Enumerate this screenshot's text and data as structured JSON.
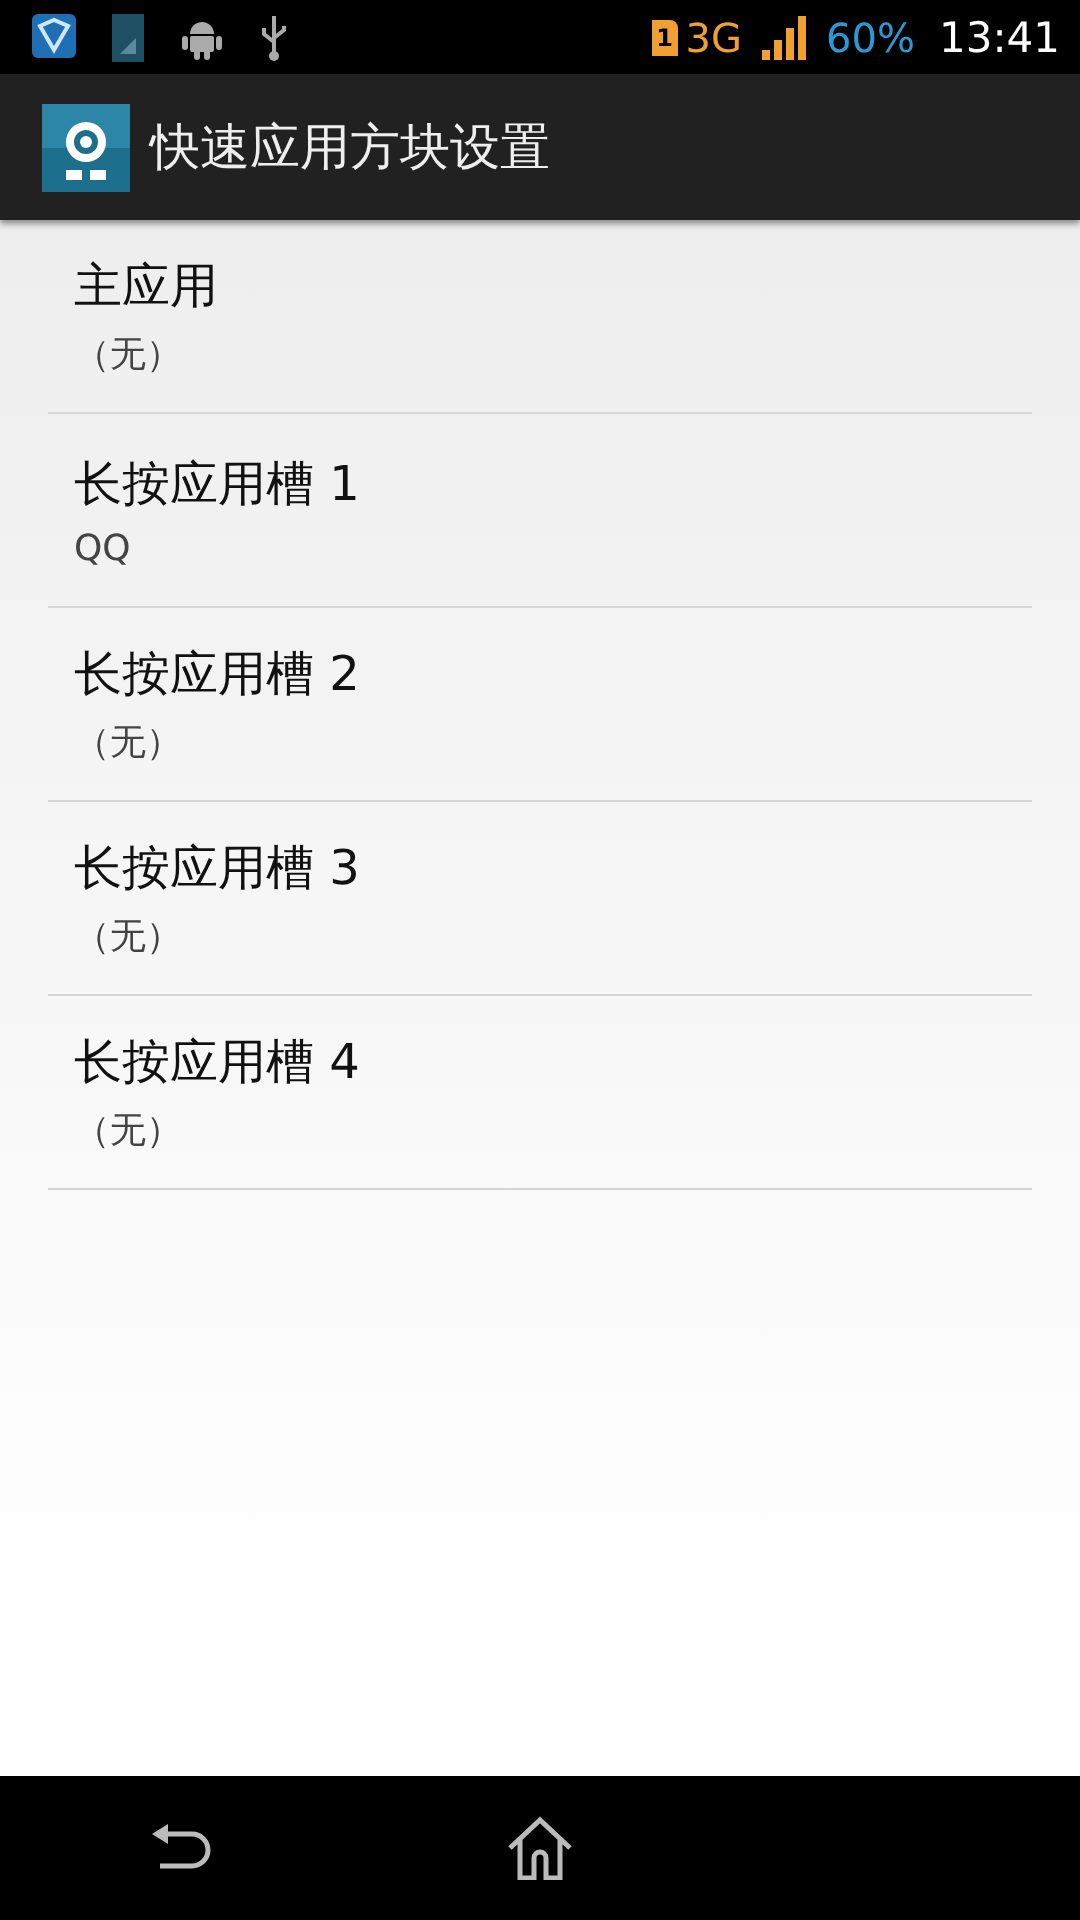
{
  "status_bar": {
    "sim_slot": "1",
    "network": "3G",
    "battery": "60%",
    "time": "13:41"
  },
  "action_bar": {
    "title": "快速应用方块设置"
  },
  "items": [
    {
      "title": "主应用",
      "summary": "（无）"
    },
    {
      "title": "长按应用槽 1",
      "summary": "QQ"
    },
    {
      "title": "长按应用槽 2",
      "summary": "（无）"
    },
    {
      "title": "长按应用槽 3",
      "summary": "（无）"
    },
    {
      "title": "长按应用槽 4",
      "summary": "（无）"
    }
  ]
}
